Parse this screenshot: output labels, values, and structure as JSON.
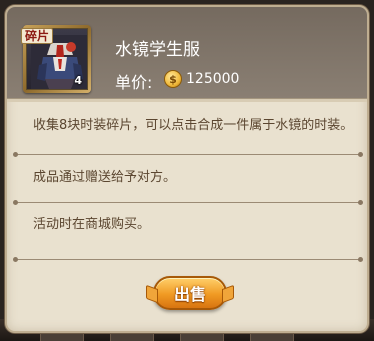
{
  "item": {
    "fragment_tag": "碎片",
    "count": "4",
    "name": "水镜学生服",
    "price_label": "单价:",
    "price_value": "125000",
    "coin_icon": "coin-icon",
    "icon": "costume-fragment-icon"
  },
  "descriptions": {
    "collect": "收集8块时装碎片，可以点击合成一件属于水镜的时装。",
    "source": "成品通过赠送给予对方。",
    "event": "活动时在商城购买。"
  },
  "actions": {
    "sell_label": "出售"
  },
  "colors": {
    "panel_bg": "#e9e1cf",
    "header_bg": "#7d7165",
    "text_brown": "#5b4630",
    "button_orange": "#f09a23",
    "coin_gold": "#f0b93b"
  }
}
